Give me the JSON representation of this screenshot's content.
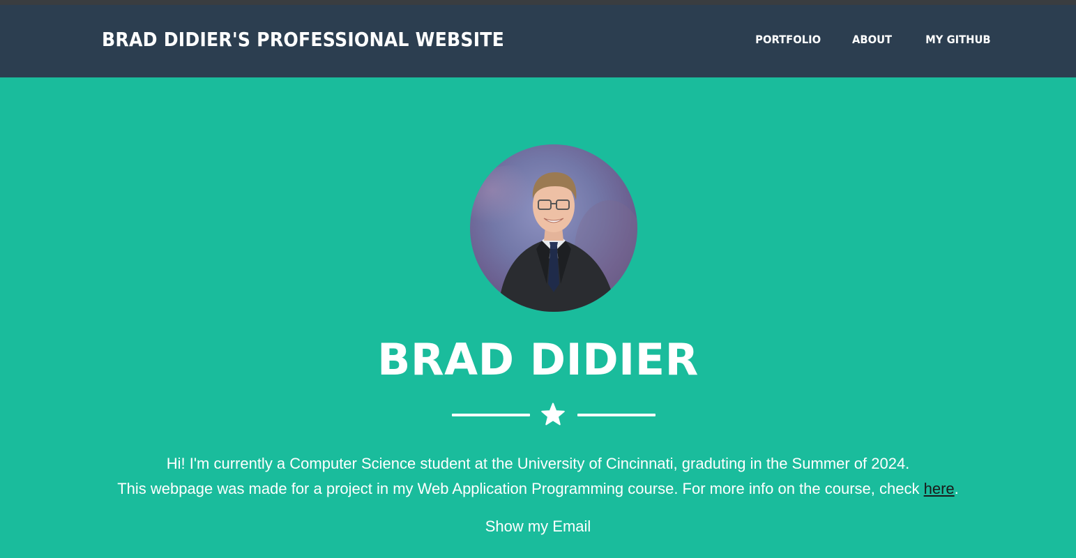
{
  "navbar": {
    "brand": "BRAD DIDIER'S PROFESSIONAL WEBSITE",
    "links": [
      {
        "label": "PORTFOLIO"
      },
      {
        "label": "ABOUT"
      },
      {
        "label": "MY GITHUB"
      }
    ]
  },
  "masthead": {
    "avatar_icon": "profile-photo",
    "name": "BRAD DIDIER",
    "divider_icon": "star-icon",
    "intro_line1": "Hi! I'm currently a Computer Science student at the University of Cincinnati, graduting in the Summer of 2024.",
    "intro_line2_prefix": "This webpage was made for a project in my Web Application Programming course. For more info on the course, check ",
    "intro_link": "here",
    "intro_line2_suffix": ".",
    "email_button": "Show my Email"
  },
  "colors": {
    "navbar_bg": "#2c3e50",
    "masthead_bg": "#1abc9c",
    "text": "#ffffff",
    "link": "#1a1a1a"
  }
}
